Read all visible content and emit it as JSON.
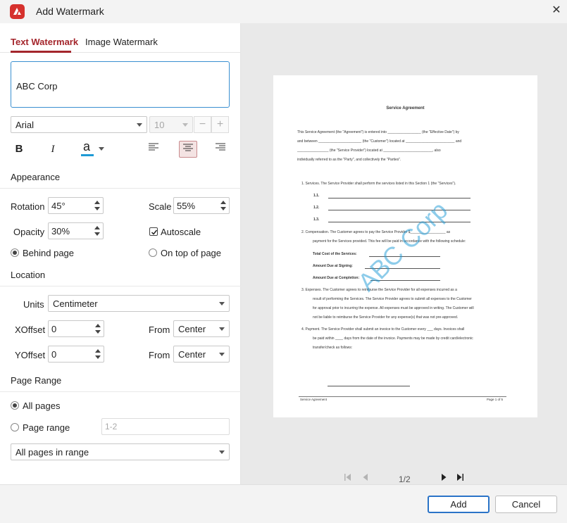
{
  "window": {
    "title": "Add Watermark"
  },
  "tabs": {
    "text": "Text Watermark",
    "image": "Image Watermark"
  },
  "text_watermark": {
    "text": "ABC Corp",
    "font": "Arial",
    "font_size": "10",
    "color": "#1e9ad6",
    "format": {
      "bold": "B",
      "italic": "I",
      "color_glyph": "a"
    }
  },
  "appearance": {
    "heading": "Appearance",
    "rotation_label": "Rotation",
    "rotation": "45°",
    "scale_label": "Scale",
    "scale": "55%",
    "opacity_label": "Opacity",
    "opacity": "30%",
    "autoscale_label": "Autoscale",
    "behind_label": "Behind page",
    "ontop_label": "On top of page"
  },
  "location": {
    "heading": "Location",
    "units_label": "Units",
    "units": "Centimeter",
    "xoffset_label": "XOffset",
    "xoffset": "0",
    "yoffset_label": "YOffset",
    "yoffset": "0",
    "from_label": "From",
    "x_from": "Center",
    "y_from": "Center"
  },
  "page_range": {
    "heading": "Page Range",
    "all_pages": "All pages",
    "page_range": "Page range",
    "range_placeholder": "1-2",
    "subset": "All pages in range"
  },
  "preview": {
    "watermark_text": "ABC Corp",
    "page_indicator": "1/2",
    "doc": {
      "title": "Service Agreement",
      "intro_1": "This Service Agreement (the \"Agreement\") is entered into _________________ (the \"Effective Date\") by",
      "intro_2": "and between ______________________ (the \"Customer\") located at _________________________ and",
      "intro_3": "________________ (the \"Service Provider\") located at _________________________, also",
      "intro_4": "individually referred to as the \"Party\", and collectively the \"Parties\".",
      "s1": "1.    Services. The Service Provider shall perform the services listed in this Section 1 (the \"Services\").",
      "s1_1": "1.1.",
      "s1_2": "1.2.",
      "s1_3": "1.3.",
      "s2_1": "2.    Compensation. The Customer agrees to pay the Service Provider $__________________ as",
      "s2_2": "payment for the Services provided. This fee will be paid in accordance with the following schedule:",
      "s2_a": "Total Cost of the Services:",
      "s2_b": "Amount Due at Signing:",
      "s2_c": "Amount Due at Completion:",
      "s3_1": "3.    Expenses. The Customer agrees to reimburse the Service Provider for all expenses incurred as a",
      "s3_2": "result of performing the Services. The Service Provider agrees to submit all expenses to the Customer",
      "s3_3": "for approval prior to incurring the expense. All expenses must be approved in writing. The Customer will",
      "s3_4": "not be liable to reimburse the Service Provider for any expense(s) that was not pre-approved.",
      "s4_1": "4.    Payment. The Service Provider shall submit an invoice to the Customer every ___ days. Invoices shall",
      "s4_2": "be paid within ____ days from the date of the invoice. Payments may be made by credit card/electronic",
      "s4_3": "transfer/check as follows:",
      "footer_left": "Service Agreement",
      "footer_right": "Page 1 of 5"
    }
  },
  "buttons": {
    "add": "Add",
    "cancel": "Cancel"
  },
  "colors": {
    "accent": "#a4262c",
    "brand_icon": "#d6312d",
    "primary_border": "#2a73c7"
  }
}
